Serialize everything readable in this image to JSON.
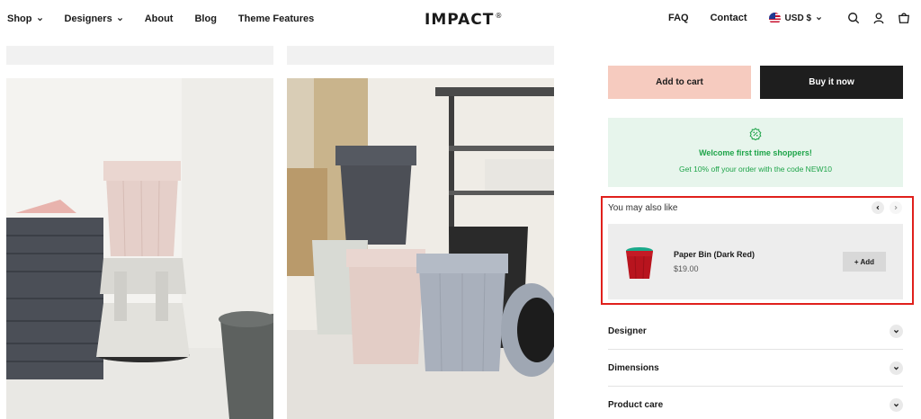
{
  "nav": {
    "left": [
      {
        "label": "Shop",
        "dropdown": true
      },
      {
        "label": "Designers",
        "dropdown": true
      },
      {
        "label": "About",
        "dropdown": false
      },
      {
        "label": "Blog",
        "dropdown": false
      },
      {
        "label": "Theme Features",
        "dropdown": false
      }
    ],
    "logo": "IMPACT",
    "logo_mark": "®",
    "right_links": [
      "FAQ",
      "Contact"
    ],
    "currency": "USD $",
    "icons": [
      "search-icon",
      "account-icon",
      "cart-icon"
    ]
  },
  "product": {
    "add_to_cart": "Add to cart",
    "buy_now": "Buy it now"
  },
  "promo": {
    "icon": "discount-icon",
    "title": "Welcome first time shoppers!",
    "subtitle": "Get 10% off your order with the code NEW10",
    "color": "#1ea449"
  },
  "recommendations": {
    "title": "You may also like",
    "items": [
      {
        "name": "Paper Bin (Dark Red)",
        "price": "$19.00",
        "add_label": "+ Add"
      }
    ]
  },
  "accordion": [
    {
      "label": "Designer"
    },
    {
      "label": "Dimensions"
    },
    {
      "label": "Product care"
    }
  ],
  "colors": {
    "add_to_cart_bg": "#f6cbbf",
    "buy_now_bg": "#1e1e1e",
    "highlight_border": "#e0201c"
  }
}
